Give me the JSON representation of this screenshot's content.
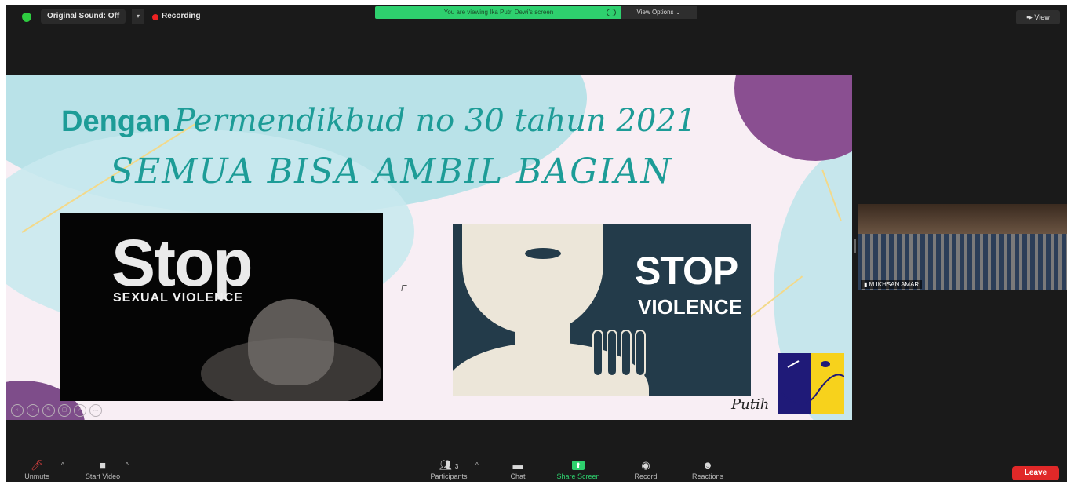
{
  "top_bar": {
    "original_sound_label": "Original Sound: Off",
    "original_sound_caret": "▾",
    "recording_label": "Recording",
    "viewing_banner": "You are viewing Ika Putri Dewi's screen",
    "view_options_label": "View Options ⌄",
    "view_label": "View"
  },
  "slide": {
    "title_sans": "Dengan",
    "title_script": "Permendikbud no 30 tahun 2021",
    "subtitle": "SEMUA BISA AMBIL BAGIAN",
    "left_image": {
      "big_word": "Stop",
      "caption": "SEXUAL VIOLENCE"
    },
    "right_image": {
      "big_word": "STOP",
      "caption": "VIOLENCE"
    },
    "logo_signature": "Putih",
    "annotation_tools": [
      "‹",
      "›",
      "✎",
      "▢",
      "⌕",
      "…"
    ]
  },
  "participant": {
    "name": "M IKHSAN AMAR"
  },
  "toolbar": {
    "unmute_label": "Unmute",
    "start_video_label": "Start Video",
    "participants_label": "Participants",
    "participants_count": "3",
    "chat_label": "Chat",
    "share_screen_label": "Share Screen",
    "record_label": "Record",
    "reactions_label": "Reactions",
    "leave_label": "Leave",
    "caret": "^"
  },
  "colors": {
    "accent_green": "#2ed06e",
    "leave_red": "#e02828",
    "slide_teal": "#1d9c97",
    "slide_purple": "#8a4f91"
  }
}
